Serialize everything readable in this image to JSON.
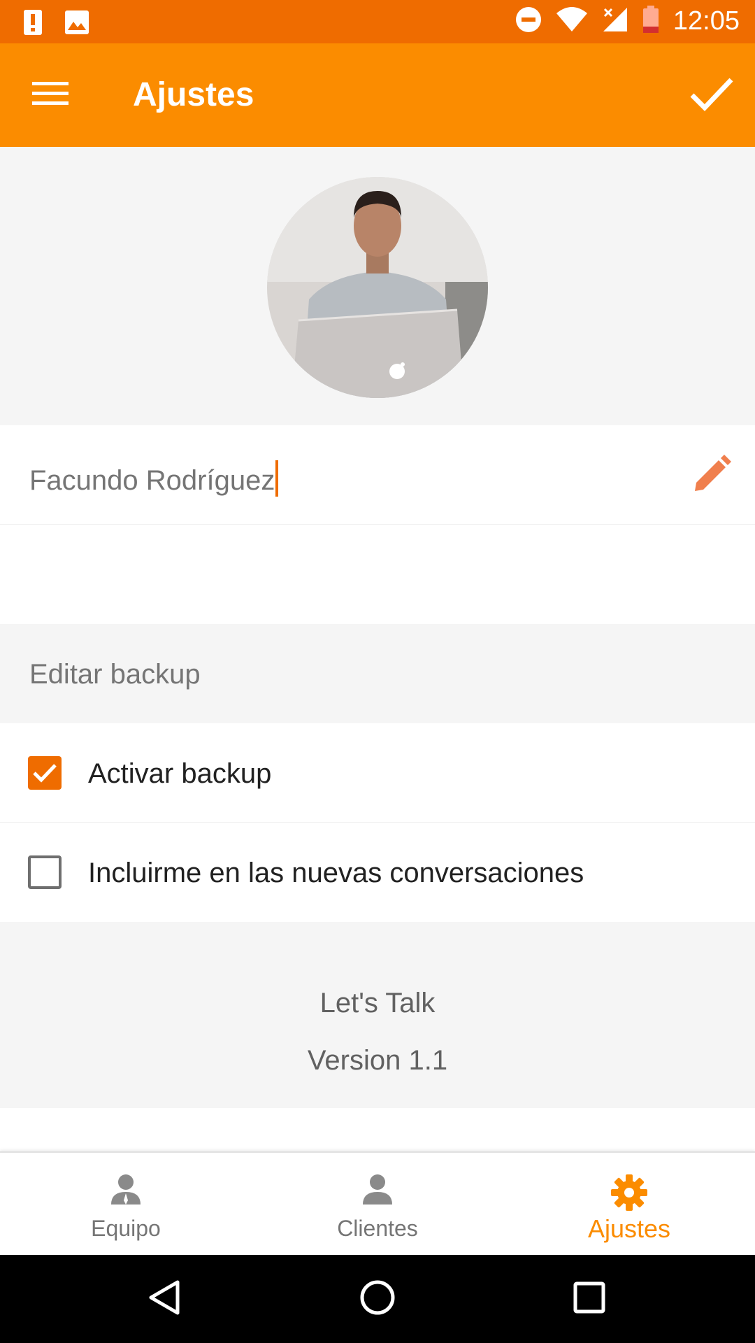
{
  "status_bar": {
    "time": "12:05",
    "icons": [
      "alert-icon",
      "image-icon",
      "do-not-disturb-icon",
      "wifi-icon",
      "signal-icon",
      "battery-icon"
    ]
  },
  "app_bar": {
    "title": "Ajustes",
    "menu_icon": "menu-icon",
    "action_icon": "check-icon"
  },
  "profile": {
    "avatar_icon": "profile-photo",
    "name": "Facundo Rodríguez",
    "edit_icon": "pencil-icon"
  },
  "backup": {
    "header": "Editar backup",
    "options": [
      {
        "label": "Activar backup",
        "checked": true
      },
      {
        "label": "Incluirme en las nuevas conversaciones",
        "checked": false
      }
    ]
  },
  "about": {
    "app_name": "Let's Talk",
    "version": "Version 1.1"
  },
  "bottom_nav": {
    "items": [
      {
        "label": "Equipo",
        "icon": "team-icon",
        "active": false
      },
      {
        "label": "Clientes",
        "icon": "person-icon",
        "active": false
      },
      {
        "label": "Ajustes",
        "icon": "settings-gear-icon",
        "active": true
      }
    ]
  },
  "colors": {
    "status_bar": "#ef6c00",
    "app_bar": "#fb8c00",
    "accent": "#ef6c00",
    "section_background": "#f5f5f5",
    "system_nav": "#000000"
  }
}
